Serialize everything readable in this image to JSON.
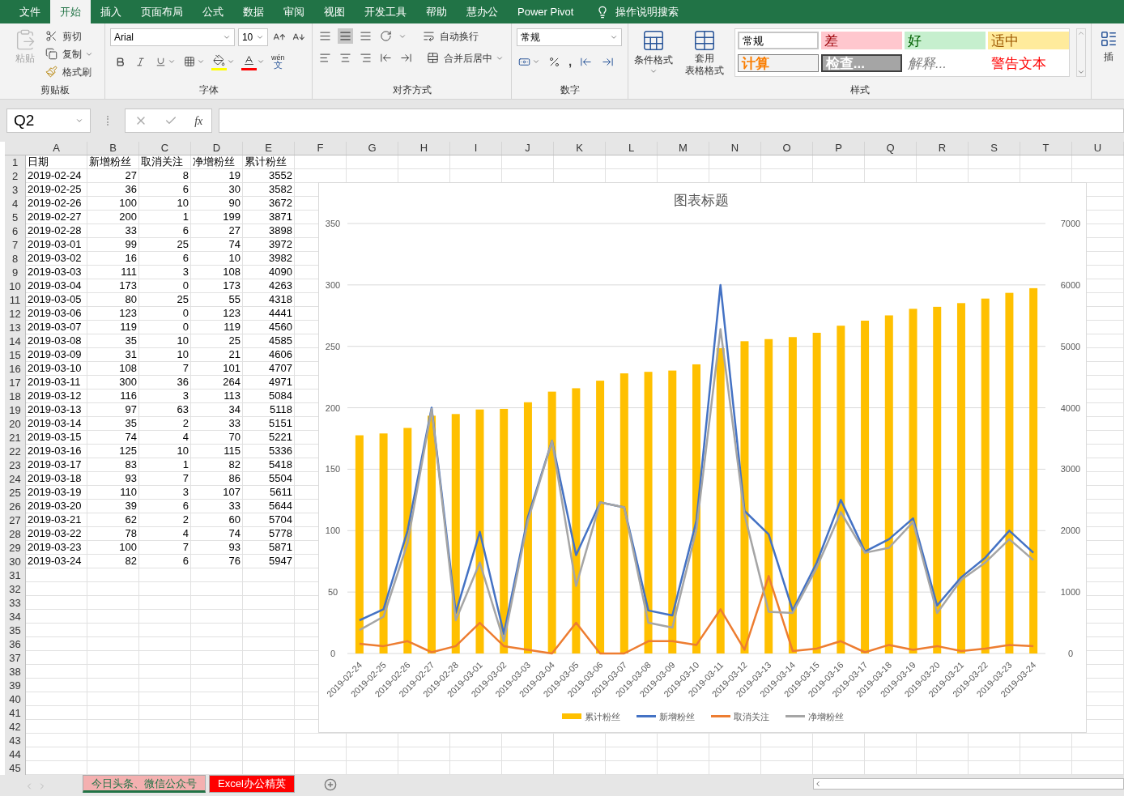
{
  "ribbon_tabs": [
    {
      "label": "文件",
      "selected": false
    },
    {
      "label": "开始",
      "selected": true
    },
    {
      "label": "插入",
      "selected": false
    },
    {
      "label": "页面布局",
      "selected": false
    },
    {
      "label": "公式",
      "selected": false
    },
    {
      "label": "数据",
      "selected": false
    },
    {
      "label": "审阅",
      "selected": false
    },
    {
      "label": "视图",
      "selected": false
    },
    {
      "label": "开发工具",
      "selected": false
    },
    {
      "label": "帮助",
      "selected": false
    },
    {
      "label": "慧办公",
      "selected": false
    },
    {
      "label": "Power Pivot",
      "selected": false
    }
  ],
  "tell_me": "操作说明搜索",
  "clipboard": {
    "paste": "粘贴",
    "cut": "剪切",
    "copy": "复制",
    "format_painter": "格式刷",
    "group": "剪贴板"
  },
  "font": {
    "name": "Arial",
    "size": "10",
    "phonetic_top": "wén",
    "phonetic_bottom": "文",
    "group": "字体"
  },
  "alignment": {
    "wrap": "自动换行",
    "merge": "合并后居中",
    "group": "对齐方式"
  },
  "number": {
    "format": "常规",
    "comma": ",",
    "group": "数字"
  },
  "styles": {
    "conditional": "条件格式",
    "table_top": "套用",
    "table_bottom": "表格格式",
    "group": "样式",
    "gallery": [
      {
        "label": "常规",
        "kind": "normal"
      },
      {
        "label": "差",
        "kind": "bad"
      },
      {
        "label": "好",
        "kind": "good"
      },
      {
        "label": "适中",
        "kind": "neutral"
      },
      {
        "label": "计算",
        "kind": "calc"
      },
      {
        "label": "检查...",
        "kind": "check"
      },
      {
        "label": "解释...",
        "kind": "explain"
      },
      {
        "label": "警告文本",
        "kind": "warning"
      }
    ]
  },
  "insert": "插",
  "formula_bar": {
    "name_box": "Q2",
    "fx": "fx"
  },
  "sheet": {
    "columns": [
      "A",
      "B",
      "C",
      "D",
      "E",
      "F",
      "G",
      "H",
      "I",
      "J",
      "K",
      "L",
      "M",
      "N",
      "O",
      "P",
      "Q",
      "R",
      "S",
      "T",
      "U"
    ],
    "row_numbers": [
      "1",
      "2",
      "3",
      "4",
      "5",
      "6",
      "7",
      "8",
      "9",
      "10",
      "11",
      "12",
      "13",
      "14",
      "15",
      "16",
      "17",
      "18",
      "19",
      "20",
      "21",
      "22",
      "23",
      "24",
      "25",
      "26",
      "27",
      "28",
      "29",
      "30",
      "31",
      "32",
      "33",
      "34",
      "35",
      "36",
      "37",
      "38",
      "39",
      "40",
      "41",
      "42",
      "43",
      "44",
      "45"
    ],
    "header_row": [
      "日期",
      "新增粉丝",
      "取消关注",
      "净增粉丝",
      "累计粉丝"
    ],
    "rows": [
      [
        "2019-02-24",
        "27",
        "8",
        "19",
        "3552"
      ],
      [
        "2019-02-25",
        "36",
        "6",
        "30",
        "3582"
      ],
      [
        "2019-02-26",
        "100",
        "10",
        "90",
        "3672"
      ],
      [
        "2019-02-27",
        "200",
        "1",
        "199",
        "3871"
      ],
      [
        "2019-02-28",
        "33",
        "6",
        "27",
        "3898"
      ],
      [
        "2019-03-01",
        "99",
        "25",
        "74",
        "3972"
      ],
      [
        "2019-03-02",
        "16",
        "6",
        "10",
        "3982"
      ],
      [
        "2019-03-03",
        "111",
        "3",
        "108",
        "4090"
      ],
      [
        "2019-03-04",
        "173",
        "0",
        "173",
        "4263"
      ],
      [
        "2019-03-05",
        "80",
        "25",
        "55",
        "4318"
      ],
      [
        "2019-03-06",
        "123",
        "0",
        "123",
        "4441"
      ],
      [
        "2019-03-07",
        "119",
        "0",
        "119",
        "4560"
      ],
      [
        "2019-03-08",
        "35",
        "10",
        "25",
        "4585"
      ],
      [
        "2019-03-09",
        "31",
        "10",
        "21",
        "4606"
      ],
      [
        "2019-03-10",
        "108",
        "7",
        "101",
        "4707"
      ],
      [
        "2019-03-11",
        "300",
        "36",
        "264",
        "4971"
      ],
      [
        "2019-03-12",
        "116",
        "3",
        "113",
        "5084"
      ],
      [
        "2019-03-13",
        "97",
        "63",
        "34",
        "5118"
      ],
      [
        "2019-03-14",
        "35",
        "2",
        "33",
        "5151"
      ],
      [
        "2019-03-15",
        "74",
        "4",
        "70",
        "5221"
      ],
      [
        "2019-03-16",
        "125",
        "10",
        "115",
        "5336"
      ],
      [
        "2019-03-17",
        "83",
        "1",
        "82",
        "5418"
      ],
      [
        "2019-03-18",
        "93",
        "7",
        "86",
        "5504"
      ],
      [
        "2019-03-19",
        "110",
        "3",
        "107",
        "5611"
      ],
      [
        "2019-03-20",
        "39",
        "6",
        "33",
        "5644"
      ],
      [
        "2019-03-21",
        "62",
        "2",
        "60",
        "5704"
      ],
      [
        "2019-03-22",
        "78",
        "4",
        "74",
        "5778"
      ],
      [
        "2019-03-23",
        "100",
        "7",
        "93",
        "5871"
      ],
      [
        "2019-03-24",
        "82",
        "6",
        "76",
        "5947"
      ]
    ]
  },
  "chart": {
    "chart_data": {
      "type": "bar",
      "title": "图表标题",
      "categories": [
        "2019-02-24",
        "2019-02-25",
        "2019-02-26",
        "2019-02-27",
        "2019-02-28",
        "2019-03-01",
        "2019-03-02",
        "2019-03-03",
        "2019-03-04",
        "2019-03-05",
        "2019-03-06",
        "2019-03-07",
        "2019-03-08",
        "2019-03-09",
        "2019-03-10",
        "2019-03-11",
        "2019-03-12",
        "2019-03-13",
        "2019-03-14",
        "2019-03-15",
        "2019-03-16",
        "2019-03-17",
        "2019-03-18",
        "2019-03-19",
        "2019-03-20",
        "2019-03-21",
        "2019-03-22",
        "2019-03-23",
        "2019-03-24"
      ],
      "grid": true,
      "legend": "bottom",
      "ylim": [
        0,
        350
      ],
      "yticks": [
        0,
        50,
        100,
        150,
        200,
        250,
        300,
        350
      ],
      "y2lim": [
        0,
        7000
      ],
      "y2ticks": [
        0,
        1000,
        2000,
        3000,
        4000,
        5000,
        6000,
        7000
      ],
      "series": [
        {
          "name": "累计粉丝",
          "color": "#ffc000",
          "type": "bar",
          "axis": "y2",
          "values": [
            3552,
            3582,
            3672,
            3871,
            3898,
            3972,
            3982,
            4090,
            4263,
            4318,
            4441,
            4560,
            4585,
            4606,
            4707,
            4971,
            5084,
            5118,
            5151,
            5221,
            5336,
            5418,
            5504,
            5611,
            5644,
            5704,
            5778,
            5871,
            5947
          ]
        },
        {
          "name": "新增粉丝",
          "color": "#4472c4",
          "type": "line",
          "values": [
            27,
            36,
            100,
            200,
            33,
            99,
            16,
            111,
            173,
            80,
            123,
            119,
            35,
            31,
            108,
            300,
            116,
            97,
            35,
            74,
            125,
            83,
            93,
            110,
            39,
            62,
            78,
            100,
            82
          ]
        },
        {
          "name": "取消关注",
          "color": "#ed7d31",
          "type": "line",
          "values": [
            8,
            6,
            10,
            1,
            6,
            25,
            6,
            3,
            0,
            25,
            0,
            0,
            10,
            10,
            7,
            36,
            3,
            63,
            2,
            4,
            10,
            1,
            7,
            3,
            6,
            2,
            4,
            7,
            6
          ]
        },
        {
          "name": "净增粉丝",
          "color": "#a5a5a5",
          "type": "line",
          "values": [
            19,
            30,
            90,
            199,
            27,
            74,
            10,
            108,
            173,
            55,
            123,
            119,
            25,
            21,
            101,
            264,
            113,
            34,
            33,
            70,
            115,
            82,
            86,
            107,
            33,
            60,
            74,
            93,
            76
          ]
        }
      ]
    }
  },
  "sheet_tabs": [
    {
      "label": "今日头条、微信公众号",
      "selected": true,
      "color": "#f4b0b0"
    },
    {
      "label": "Excel办公精英",
      "selected": false,
      "color": "#ff0000"
    }
  ]
}
